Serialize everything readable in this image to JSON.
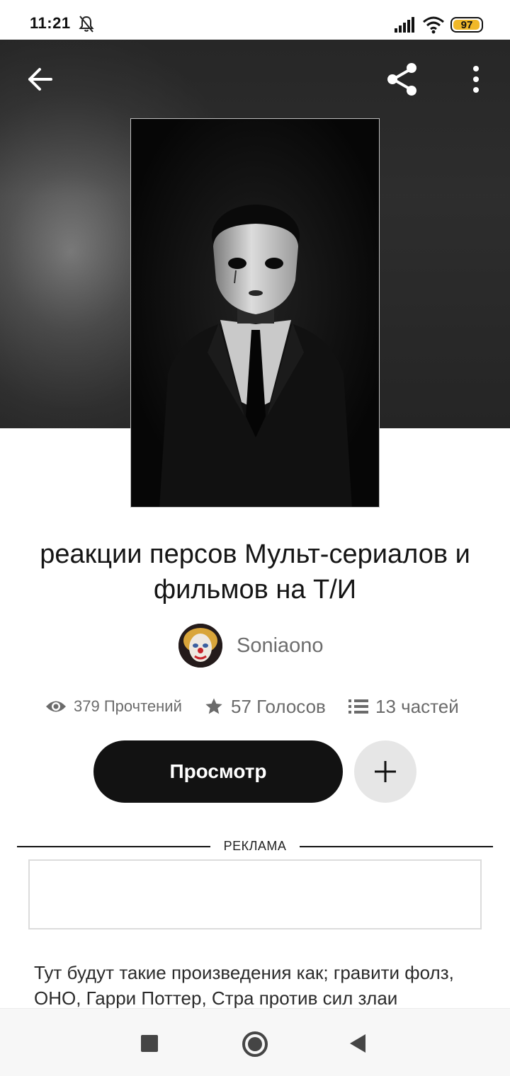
{
  "status_bar": {
    "time": "11:21",
    "battery": "97",
    "icons": [
      "bell-off-icon",
      "signal-icon",
      "wifi-icon",
      "battery-icon"
    ],
    "battery_color": "#f1b829"
  },
  "toolbar": {
    "back_icon": "arrow-left-icon",
    "share_icon": "share-icon",
    "more_icon": "more-vertical-icon"
  },
  "story": {
    "title": "реакции персов Мульт-сериалов и фильмов на Т/И",
    "author": "Soniaono",
    "reads": "379 Прочтений",
    "votes": "57 Голосов",
    "parts": "13 частей",
    "read_button": "Просмотр",
    "add_icon": "plus-icon",
    "description": "Тут будут такие произведения как; гравити фолз, ОНО, Гарри Поттер, Стра против сил злаи"
  },
  "ad": {
    "label": "РЕКЛАМА"
  },
  "nav_bar": {
    "icons": [
      "recents-square-icon",
      "home-circle-icon",
      "back-triangle-icon"
    ]
  },
  "colors": {
    "primary_button": "#121212",
    "secondary_button": "#e6e6e6",
    "muted_text": "#6b6b6b"
  }
}
